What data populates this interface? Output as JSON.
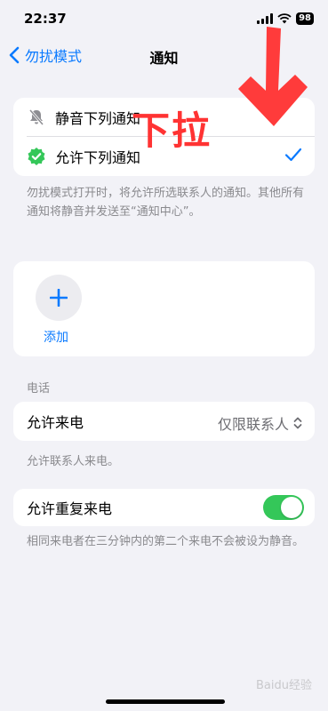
{
  "status_bar": {
    "time": "22:37",
    "battery": "98"
  },
  "nav": {
    "back_label": "勿扰模式",
    "title": "通知"
  },
  "notifications": {
    "option_silence": "静音下列通知",
    "option_allow": "允许下列通知",
    "footnote": "勿扰模式打开时，将允许所选联系人的通知。其他所有通知将静音并发送至“通知中心”。"
  },
  "contacts": {
    "add_label": "添加"
  },
  "phone": {
    "header": "电话",
    "allow_calls_label": "允许来电",
    "allow_calls_value": "仅限联系人",
    "allow_calls_footnote": "允许联系人来电。",
    "repeat_calls_label": "允许重复来电",
    "repeat_calls_on": true,
    "repeat_calls_footnote": "相同来电者在三分钟内的第二个来电不会被设为静音。"
  },
  "annotation": {
    "text": "下拉"
  },
  "watermark": "Baidu经验",
  "colors": {
    "accent": "#0a7aff",
    "toggle_on": "#34c759",
    "annotation": "#ff3333"
  }
}
